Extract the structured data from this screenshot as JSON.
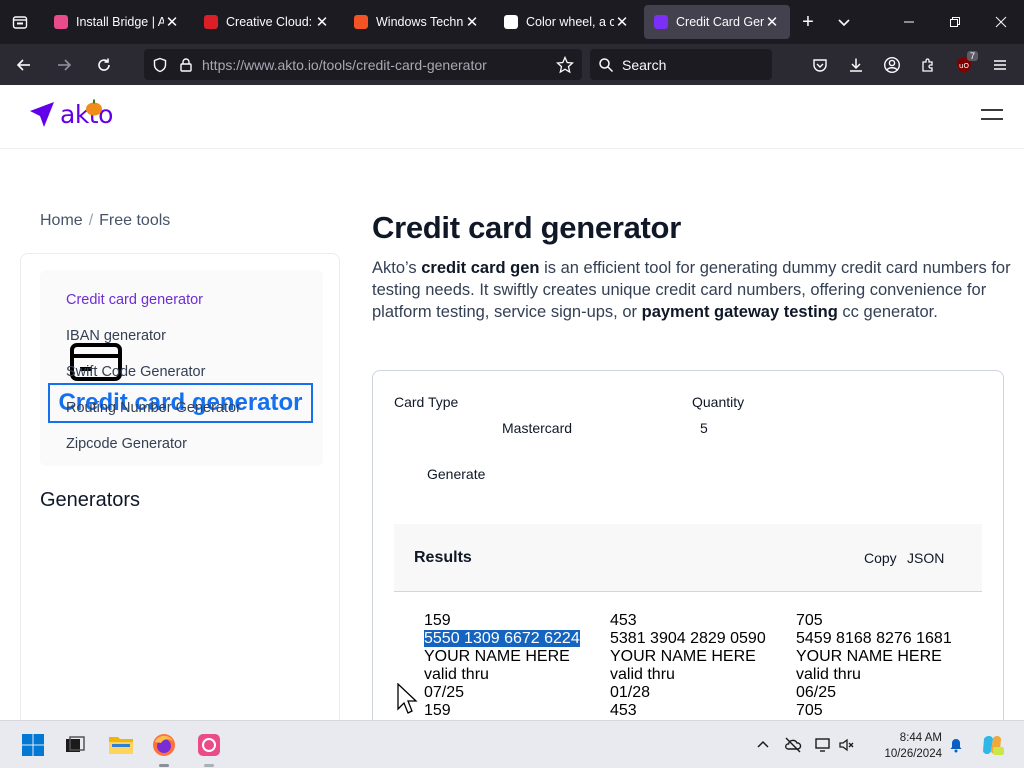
{
  "browser": {
    "tabs": [
      {
        "label": "Install Bridge | A",
        "favicon_color": "#e94b8c",
        "active": false
      },
      {
        "label": "Creative Cloud: I",
        "favicon_color": "#da1f26",
        "active": false
      },
      {
        "label": "Windows Techni",
        "favicon_color": "#f35325",
        "active": false
      },
      {
        "label": "Color wheel, a c",
        "favicon_color": "#ffffff",
        "active": false
      },
      {
        "label": "Credit Card Gen",
        "favicon_color": "#7b2ff7",
        "active": true
      }
    ],
    "url": "https://www.akto.io/tools/credit-card-generator",
    "search_label": "Search",
    "extension_badge": "7"
  },
  "site": {
    "logo_text": "akto",
    "breadcrumb": {
      "home": "Home",
      "separator": "/",
      "current": "Free tools"
    },
    "sidebar": {
      "card_title": "Credit card generator",
      "generators_heading": "Generators",
      "items": [
        {
          "label": "Credit card generator",
          "active": true
        },
        {
          "label": "IBAN generator",
          "active": false
        },
        {
          "label": "Swift Code Generator",
          "active": false
        },
        {
          "label": "Routing Number Generator",
          "active": false
        },
        {
          "label": "Zipcode Generator",
          "active": false
        }
      ]
    },
    "main": {
      "title": "Credit card generator",
      "desc": {
        "p1": "Akto’s ",
        "b1": "credit card gen",
        "p2": " is an efficient tool for generating dummy credit card numbers for testing needs. It swiftly creates unique credit card numbers, offering convenience for platform testing, service sign-ups, or ",
        "b2": "payment gateway testing",
        "p3": " cc generator."
      },
      "form": {
        "card_type_label": "Card Type",
        "card_type_value": "Mastercard",
        "quantity_label": "Quantity",
        "quantity_value": "5",
        "generate_label": "Generate"
      },
      "results": {
        "title": "Results",
        "copy_label": "Copy",
        "json_label": "JSON",
        "cards": [
          {
            "cvv": "159",
            "number": "5550 1309 6672 6224",
            "name": "YOUR NAME HERE",
            "valid_label": "valid thru",
            "expiry": "07/25",
            "cvv2": "159",
            "selected": true
          },
          {
            "cvv": "453",
            "number": "5381 3904 2829 0590",
            "name": "YOUR NAME HERE",
            "valid_label": "valid thru",
            "expiry": "01/28",
            "cvv2": "453",
            "selected": false
          },
          {
            "cvv": "705",
            "number": "5459 8168 8276 1681",
            "name": "YOUR NAME HERE",
            "valid_label": "valid thru",
            "expiry": "06/25",
            "cvv2": "705",
            "selected": false
          }
        ]
      }
    }
  },
  "taskbar": {
    "time": "8:44 AM",
    "date": "10/26/2024"
  }
}
